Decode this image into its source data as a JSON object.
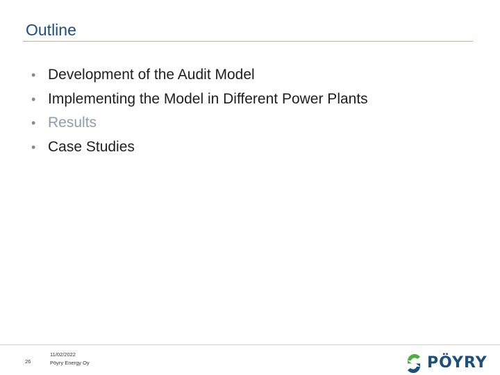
{
  "slide": {
    "title": "Outline",
    "bullets": [
      {
        "text": "Development of the Audit Model",
        "dim": false
      },
      {
        "text": "Implementing the Model in Different Power Plants",
        "dim": false
      },
      {
        "text": "Results",
        "dim": true
      },
      {
        "text": "Case Studies",
        "dim": false
      }
    ],
    "bullet_glyph": "•"
  },
  "footer": {
    "page_number": "26",
    "date": "11/02/2022",
    "company": "Pöyry Energy Oy"
  },
  "logo": {
    "text": "PÖYRY",
    "icon": "poyry-logo-icon"
  },
  "colors": {
    "title": "#1c4f7c",
    "rule": "#e7a58a",
    "dim_text": "#8e9eaa",
    "logo_green": "#4fae3f",
    "logo_blue": "#1c4f7c"
  }
}
